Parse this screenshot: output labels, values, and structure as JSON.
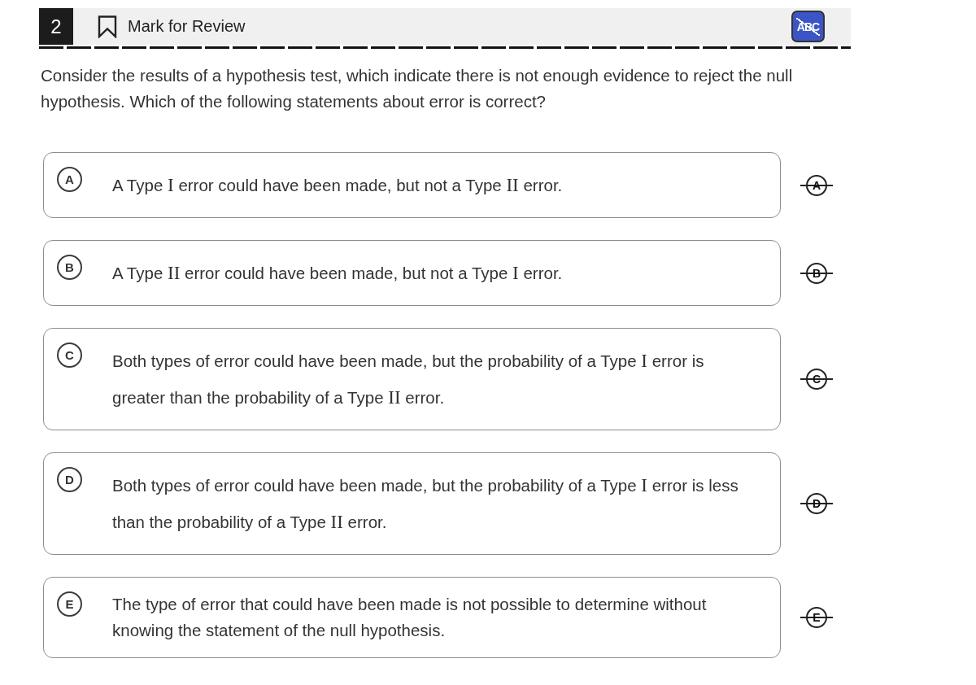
{
  "header": {
    "question_number": "2",
    "mark_for_review": {
      "label": "Mark for Review",
      "marked": false
    },
    "cross_out_tool": {
      "label": "ABC",
      "on": true
    }
  },
  "question": "Consider the results of a hypothesis test, which indicate there is not enough evidence to reject the null hypothesis. Which of the following statements about error is correct?",
  "options": [
    {
      "letter": "A",
      "selected": false,
      "segments": [
        {
          "kind": "text",
          "text": "A Type "
        },
        {
          "kind": "math",
          "text": "I"
        },
        {
          "kind": "text",
          "text": " error could have been made, but not a Type "
        },
        {
          "kind": "math",
          "text": "II"
        },
        {
          "kind": "text",
          "text": " error."
        }
      ],
      "cross_out_letter": "A"
    },
    {
      "letter": "B",
      "selected": false,
      "segments": [
        {
          "kind": "text",
          "text": "A Type "
        },
        {
          "kind": "math",
          "text": "II"
        },
        {
          "kind": "text",
          "text": " error could have been made, but not a Type "
        },
        {
          "kind": "math",
          "text": "I"
        },
        {
          "kind": "text",
          "text": " error."
        }
      ],
      "cross_out_letter": "B"
    },
    {
      "letter": "C",
      "selected": false,
      "segments": [
        {
          "kind": "text",
          "text": "Both types of error could have been made, but the probability of a Type "
        },
        {
          "kind": "math",
          "text": "I"
        },
        {
          "kind": "text",
          "text": " error is greater than the probability of a Type "
        },
        {
          "kind": "math",
          "text": "II"
        },
        {
          "kind": "text",
          "text": " error."
        }
      ],
      "cross_out_letter": "C"
    },
    {
      "letter": "D",
      "selected": false,
      "segments": [
        {
          "kind": "text",
          "text": "Both types of error could have been made, but the probability of a Type "
        },
        {
          "kind": "math",
          "text": "I"
        },
        {
          "kind": "text",
          "text": " error is less than the probability of a Type "
        },
        {
          "kind": "math",
          "text": "II"
        },
        {
          "kind": "text",
          "text": " error."
        }
      ],
      "cross_out_letter": "D"
    },
    {
      "letter": "E",
      "selected": false,
      "segments": [
        {
          "kind": "text",
          "text": "The type of error that could have been made is not possible to determine without knowing the statement of the null hypothesis."
        }
      ],
      "cross_out_letter": "E"
    }
  ]
}
